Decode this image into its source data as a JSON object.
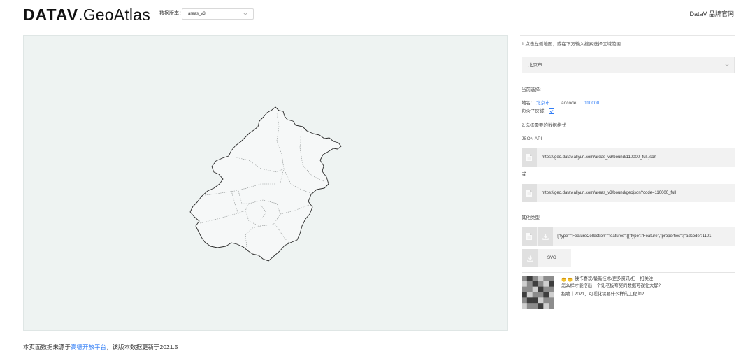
{
  "header": {
    "logo_bold": "DATAV",
    "logo_light": ".GeoAtlas",
    "version_label": "数据版本：",
    "version_value": "areas_v3",
    "brand_link": "DataV 品牌官网"
  },
  "panel": {
    "step1": "1.点击左侧地图，或在下方输入搜索选择区域范围",
    "region_value": "北京市",
    "current_label": "当前选择:",
    "name_label": "地名:",
    "name_value": "北京市",
    "adcode_label": "adcode:",
    "adcode_value": "110000",
    "include_label": "包含子区域",
    "include_checked": true,
    "step2": "2.选择需要的数据格式",
    "json_api_label": "JSON API",
    "url_full": "https://geo.datav.aliyun.com/areas_v3/bound/110000_full.json",
    "or_label": "或",
    "url_geojson": "https://geo.datav.aliyun.com/areas_v3/bound/geojson?code=110000_full",
    "other_label": "其他类型",
    "geojson_preview": "{\"type\":\"FeatureCollection\",\"features\":[{\"type\":\"Feature\",\"properties\":{\"adcode\":1101",
    "svg_label": "SVG"
  },
  "promo": {
    "line1": "操作喜欢/最新技术/更多资讯/扫一扫关注",
    "line2": "怎么样才能搭出一个让老板夸奖的数据可视化大屏?",
    "line3": "招聘｜2021，可视化需要什么样的工程师?"
  },
  "footer": {
    "prefix": "本页面数据来源于",
    "link": "高德开放平台",
    "suffix": "，该版本数据更新于2021.5"
  },
  "icons": {
    "select_arrow": "chevron-down-icon",
    "copy": "file-icon",
    "download": "download-icon",
    "checkbox": "checkbox-checked-icon",
    "promo": "pointing-hand-icon"
  },
  "colors": {
    "accent": "#2f7cf6",
    "map_background": "#eef3f2"
  }
}
